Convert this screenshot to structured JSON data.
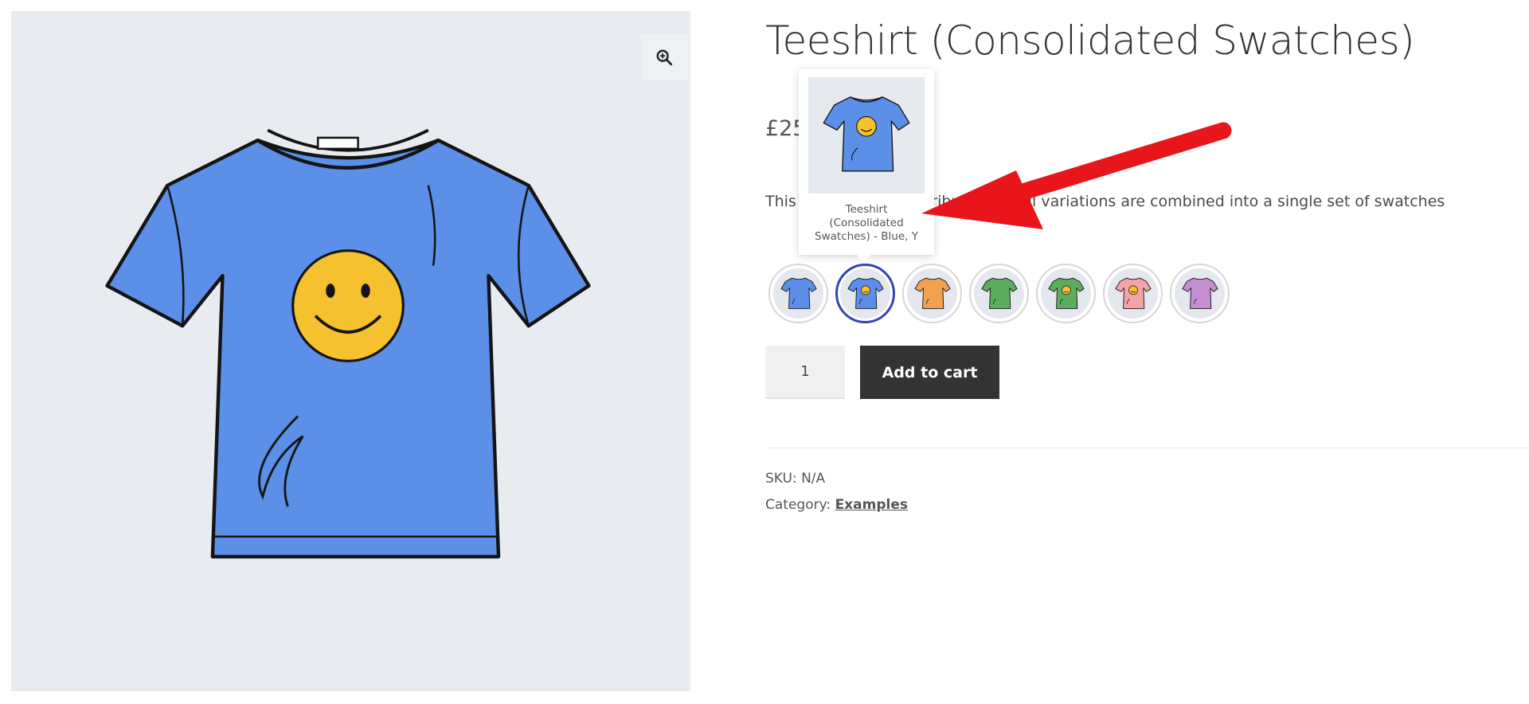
{
  "product": {
    "title": "Teeshirt (Consolidated Swatches)",
    "price": "£25",
    "description": "This product has 2 attributes but all variations are combined into a single set of swatches"
  },
  "gallery": {
    "zoom_icon": "zoom-in-icon"
  },
  "tooltip": {
    "caption": "Teeshirt (Consolidated Swatches) - Blue, Y"
  },
  "swatches": [
    {
      "color": "Blue",
      "hex": "#5b8fe8",
      "smiley": false
    },
    {
      "color": "Blue",
      "hex": "#5b8fe8",
      "smiley": true,
      "selected": true
    },
    {
      "color": "Orange",
      "hex": "#f2a24f",
      "smiley": false
    },
    {
      "color": "Green",
      "hex": "#5cae5f",
      "smiley": false
    },
    {
      "color": "Green",
      "hex": "#5cae5f",
      "smiley": true
    },
    {
      "color": "Pink",
      "hex": "#f4a3a8",
      "smiley": true
    },
    {
      "color": "Purple",
      "hex": "#c58ed1",
      "smiley": false
    }
  ],
  "cart": {
    "quantity": "1",
    "add_label": "Add to cart"
  },
  "meta": {
    "sku_label": "SKU:",
    "sku_value": "N/A",
    "category_label": "Category:",
    "category_value": "Examples"
  },
  "colors": {
    "button_bg": "#333333",
    "swatch_selected_border": "#3445b4",
    "arrow": "#e8161b"
  }
}
